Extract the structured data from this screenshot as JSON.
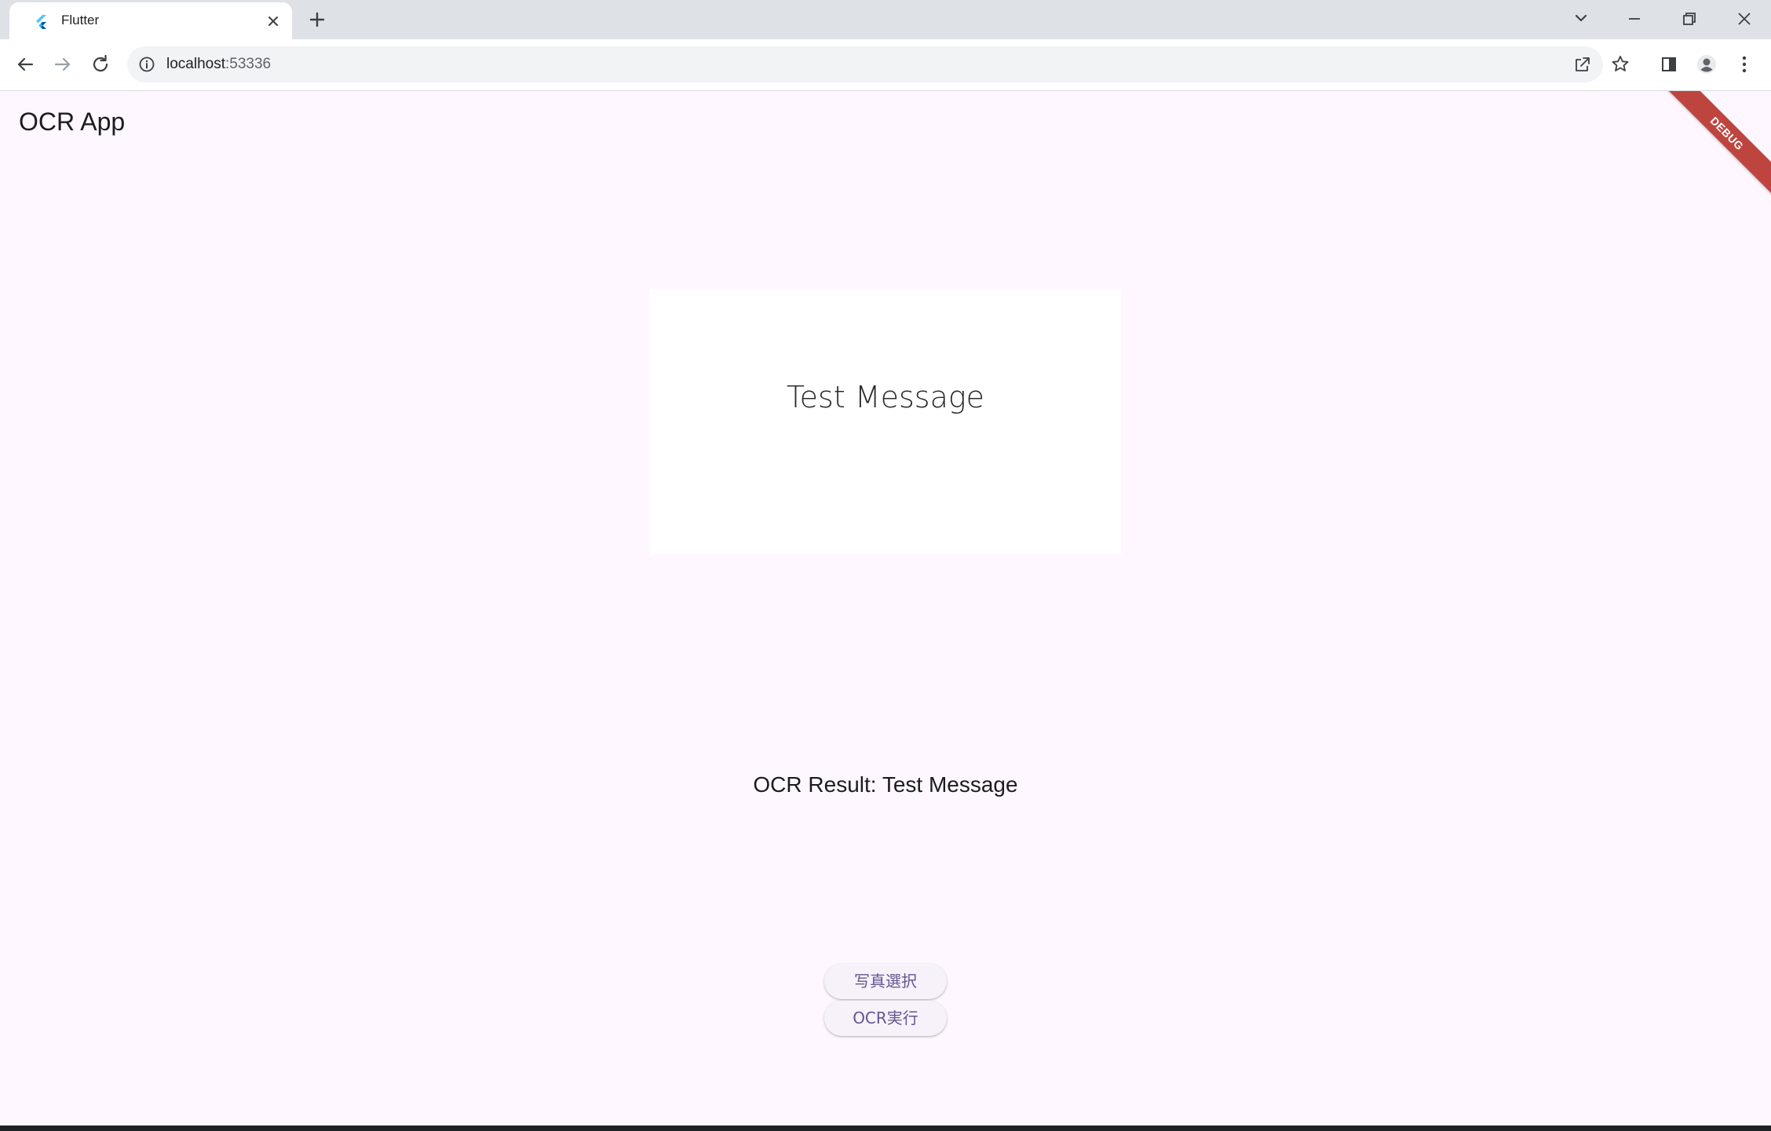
{
  "browser": {
    "tab_title": "Flutter",
    "url_host": "localhost",
    "url_port": ":53336"
  },
  "app": {
    "title": "OCR App",
    "debug_label": "DEBUG",
    "preview_text": "Test Message",
    "result_text": "OCR Result: Test Message",
    "buttons": {
      "select_photo": "写真選択",
      "run_ocr": "OCR実行"
    }
  },
  "colors": {
    "app_background": "#fef7ff",
    "accent": "#65558f",
    "debug_banner": "#b3261e"
  }
}
